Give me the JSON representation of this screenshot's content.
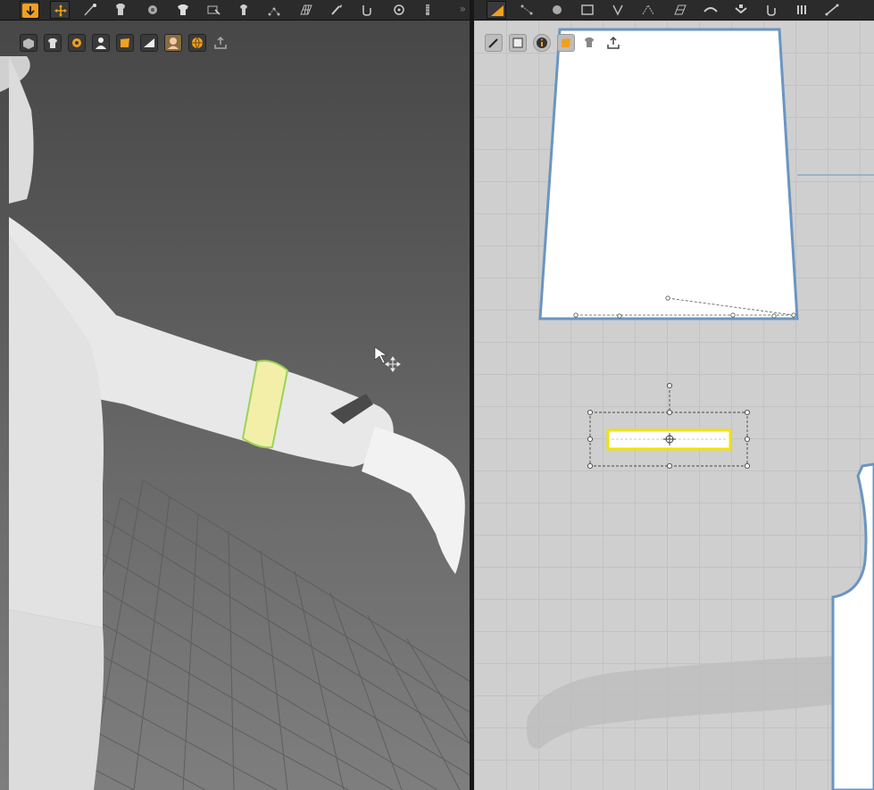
{
  "toolbar_3d": {
    "buttons": [
      {
        "icon": "arrow-down-icon"
      },
      {
        "icon": "move-select-icon"
      },
      {
        "icon": "pin-tool-icon"
      },
      {
        "icon": "garment-fold-icon"
      },
      {
        "icon": "tack-icon"
      },
      {
        "icon": "avatar-dress-icon"
      },
      {
        "icon": "select-mesh-icon"
      },
      {
        "icon": "shirt-arrange-icon"
      },
      {
        "icon": "point-edit-icon"
      },
      {
        "icon": "grid-mesh-icon"
      },
      {
        "icon": "brush-tool-icon"
      },
      {
        "icon": "tape-tool-icon"
      },
      {
        "icon": "button-tool-icon"
      },
      {
        "icon": "zipper-tool-icon"
      }
    ],
    "overflow_icon": "double-chevron-right-icon"
  },
  "toolbar_2d": {
    "buttons": [
      {
        "icon": "transform-pattern-icon"
      },
      {
        "icon": "edit-point-icon"
      },
      {
        "icon": "circle-tool-icon"
      },
      {
        "icon": "rectangle-tool-icon"
      },
      {
        "icon": "dart-tool-icon"
      },
      {
        "icon": "seam-line-icon"
      },
      {
        "icon": "grid-fabric-icon"
      },
      {
        "icon": "sewing-tool-icon"
      },
      {
        "icon": "segment-sew-icon"
      },
      {
        "icon": "tack-2d-icon"
      },
      {
        "icon": "fold-tool-icon"
      },
      {
        "icon": "measure-tool-icon"
      }
    ]
  },
  "viewport_3d": {
    "floating_icons": [
      "fabric-display-icon",
      "garment-visibility-icon",
      "texture-icon",
      "avatar-visibility-icon",
      "pattern-color-icon",
      "shading-icon",
      "skin-display-icon",
      "world-view-icon",
      "export-icon"
    ]
  },
  "viewport_2d": {
    "floating_icons": [
      "pen-tool-icon",
      "pattern-select-icon",
      "info-icon",
      "pattern-color-icon",
      "garment-icon",
      "export-icon"
    ]
  },
  "colors": {
    "toolbar_bg": "#2b2b2b",
    "accent_orange": "#f0a020",
    "selection_yellow": "#f5f08a",
    "pattern_outline": "#6a95c2",
    "grid_bg": "#cfcfcf"
  }
}
